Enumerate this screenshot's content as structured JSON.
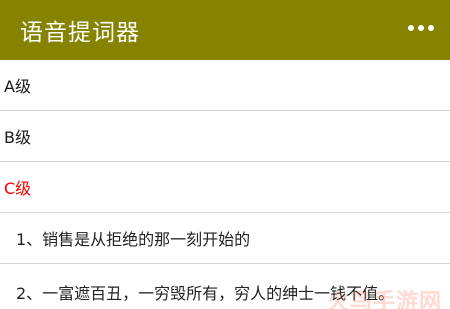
{
  "app_bar": {
    "title": "语音提词器",
    "background": "#868300",
    "menu_icon": "more-vertical-dots-icon"
  },
  "levels": [
    {
      "label": "A级",
      "active": false
    },
    {
      "label": "B级",
      "active": false
    },
    {
      "label": "C级",
      "active": true
    }
  ],
  "items": [
    {
      "label": "1、销售是从拒绝的那一刻开始的"
    },
    {
      "label": "2、一富遮百丑，一穷毁所有，穷人的绅士一钱不值。"
    }
  ],
  "active_color": "#ff0000",
  "watermark": "火鸟手游网"
}
